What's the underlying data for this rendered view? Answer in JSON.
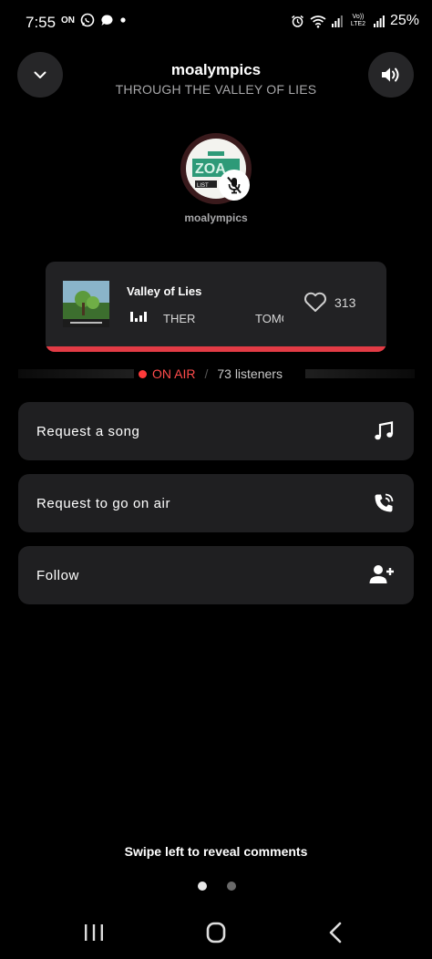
{
  "status_bar": {
    "time": "7:55",
    "left_icons": [
      "notification-on-icon",
      "whatsapp-icon",
      "chat-bubble-icon",
      "dot-icon"
    ],
    "left_badge": "ON",
    "right_icons": [
      "alarm-icon",
      "wifi-icon",
      "signal-icon",
      "volte-icon",
      "signal-icon"
    ],
    "volte_label": "Vo)) LTE2",
    "battery": "25%"
  },
  "header": {
    "title": "moalympics",
    "subtitle": "THROUGH THE VALLEY OF LIES",
    "back_icon": "chevron-down-icon",
    "volume_icon": "volume-icon"
  },
  "host": {
    "name": "moalympics",
    "avatar_text": "LIST",
    "mic_status": "muted"
  },
  "now_playing": {
    "title": "Valley of Lies",
    "ticker_1": "THER",
    "ticker_2": "TOMORI",
    "likes": "313",
    "accent": "#e23b45"
  },
  "live": {
    "status": "ON AIR",
    "listeners": "73 listeners"
  },
  "actions": [
    {
      "label": "Request a song",
      "icon": "music-note-icon"
    },
    {
      "label": "Request to go on air",
      "icon": "phone-call-icon"
    },
    {
      "label": "Follow",
      "icon": "add-user-icon"
    }
  ],
  "swipe_hint": "Swipe left to reveal comments",
  "pager": {
    "pages": 2,
    "active": 1
  }
}
